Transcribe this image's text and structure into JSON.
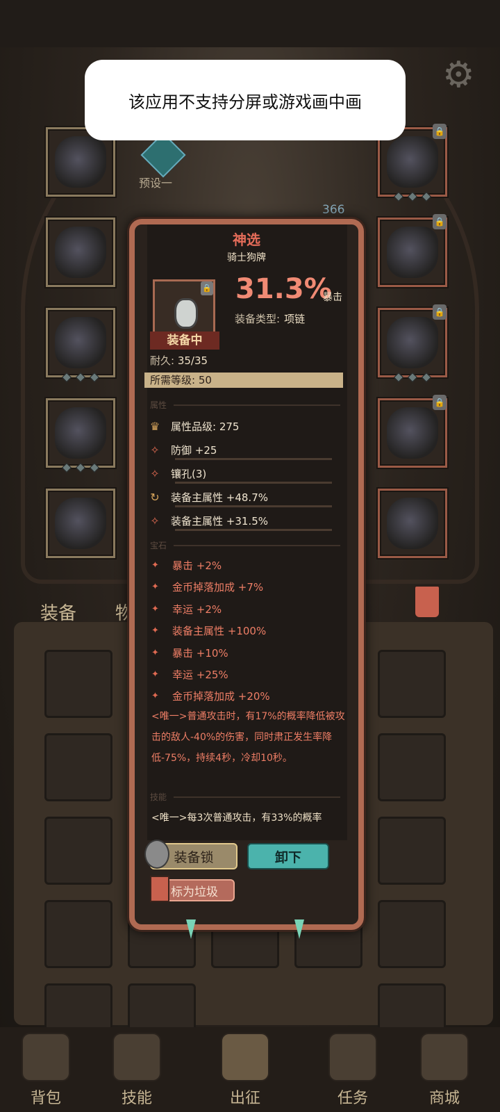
{
  "toast": {
    "message": "该应用不支持分屏或游戏画中画"
  },
  "equip_screen": {
    "preset_label": "预设一",
    "count": "366"
  },
  "bag_tabs": [
    "装备",
    "物品"
  ],
  "bottom_nav": [
    {
      "label": "背包",
      "icon": "backpack-icon"
    },
    {
      "label": "技能",
      "icon": "skill-book-icon"
    },
    {
      "label": "出征",
      "icon": "sword-map-icon"
    },
    {
      "label": "任务",
      "icon": "scroll-icon"
    },
    {
      "label": "商城",
      "icon": "shop-crest-icon"
    }
  ],
  "item": {
    "rarity": "神选",
    "name": "骑士狗牌",
    "crit_value": "31.3%",
    "crit_label": "暴击",
    "type_label": "装备类型:",
    "type_value": "项链",
    "equipped_label": "装备中",
    "durability_label": "耐久:",
    "durability_value": "35/35",
    "required_level": "所需等级: 50",
    "section_attributes": "属性",
    "attributes": [
      {
        "text": "属性品级: 275",
        "icon": "crest-icon"
      },
      {
        "text": "防御 +25",
        "icon": "diamond-star-icon"
      },
      {
        "text": "镶孔(3)",
        "icon": "diamond-star-icon"
      },
      {
        "text": "装备主属性 +48.7%",
        "icon": "refresh-icon"
      },
      {
        "text": "装备主属性 +31.5%",
        "icon": "diamond-star-icon"
      }
    ],
    "section_gems": "宝石",
    "gems": [
      "暴击 +2%",
      "金币掉落加成 +7%",
      "幸运 +2%",
      "装备主属性 +100%",
      "暴击 +10%",
      "幸运 +25%",
      "金币掉落加成 +20%"
    ],
    "unique_effect": "<唯一>普通攻击时，有17%的概率降低被攻击的敌人-40%的伤害，同时肃正发生率降低-75%，持续4秒，冷却10秒。",
    "section_skills": "技能",
    "skill_text": "<唯一>每3次普通攻击，有33%的概率",
    "btn_lock": "装备锁",
    "btn_unequip": "卸下",
    "btn_trash": "标为垃圾"
  }
}
